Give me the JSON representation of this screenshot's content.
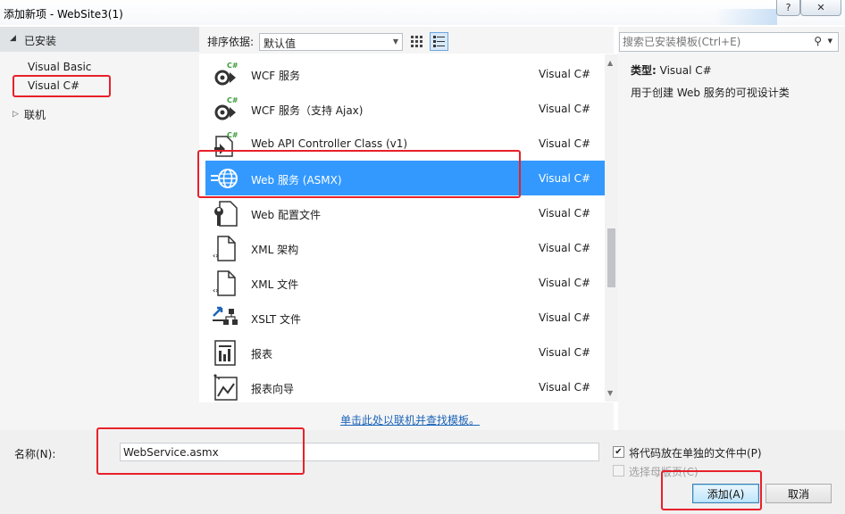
{
  "window": {
    "title": "添加新项 - WebSite3(1)",
    "help_glyph": "?",
    "close_glyph": "✕"
  },
  "left_panel": {
    "installed_label": "已安装",
    "items": [
      {
        "label": "Visual Basic"
      },
      {
        "label": "Visual C#"
      }
    ],
    "online_label": "联机"
  },
  "sort_bar": {
    "label": "排序依据:",
    "selected": "默认值"
  },
  "templates": [
    {
      "name": "WCF 服务",
      "lang": "Visual C#",
      "icon": "wcf-service-icon"
    },
    {
      "name": "WCF 服务（支持 Ajax)",
      "lang": "Visual C#",
      "icon": "wcf-ajax-service-icon"
    },
    {
      "name": "Web API Controller Class (v1)",
      "lang": "Visual C#",
      "icon": "web-api-controller-icon"
    },
    {
      "name": "Web 服务 (ASMX)",
      "lang": "Visual C#",
      "icon": "web-service-globe-icon",
      "selected": true
    },
    {
      "name": "Web 配置文件",
      "lang": "Visual C#",
      "icon": "web-config-wrench-icon"
    },
    {
      "name": "XML 架构",
      "lang": "Visual C#",
      "icon": "xml-schema-icon"
    },
    {
      "name": "XML 文件",
      "lang": "Visual C#",
      "icon": "xml-file-icon"
    },
    {
      "name": "XSLT 文件",
      "lang": "Visual C#",
      "icon": "xslt-file-icon"
    },
    {
      "name": "报表",
      "lang": "Visual C#",
      "icon": "report-icon"
    },
    {
      "name": "报表向导",
      "lang": "Visual C#",
      "icon": "report-wizard-icon"
    }
  ],
  "online_link": "单击此处以联机并查找模板。",
  "search": {
    "placeholder": "搜索已安装模板(Ctrl+E)"
  },
  "details": {
    "type_label": "类型:",
    "type_value": "Visual C#",
    "description": "用于创建 Web 服务的可视设计类"
  },
  "bottom": {
    "name_label": "名称(N):",
    "name_value": "WebService.asmx",
    "separate_file_label": "将代码放在单独的文件中(P)",
    "separate_file_checked": true,
    "master_page_label": "选择母版页(C)",
    "master_page_checked": false,
    "add_label": "添加(A)",
    "cancel_label": "取消"
  },
  "colors": {
    "selection": "#3399ff",
    "highlight_box": "#e8202a",
    "link": "#1b64b8",
    "csharp_badge": "#3a9a3a"
  }
}
